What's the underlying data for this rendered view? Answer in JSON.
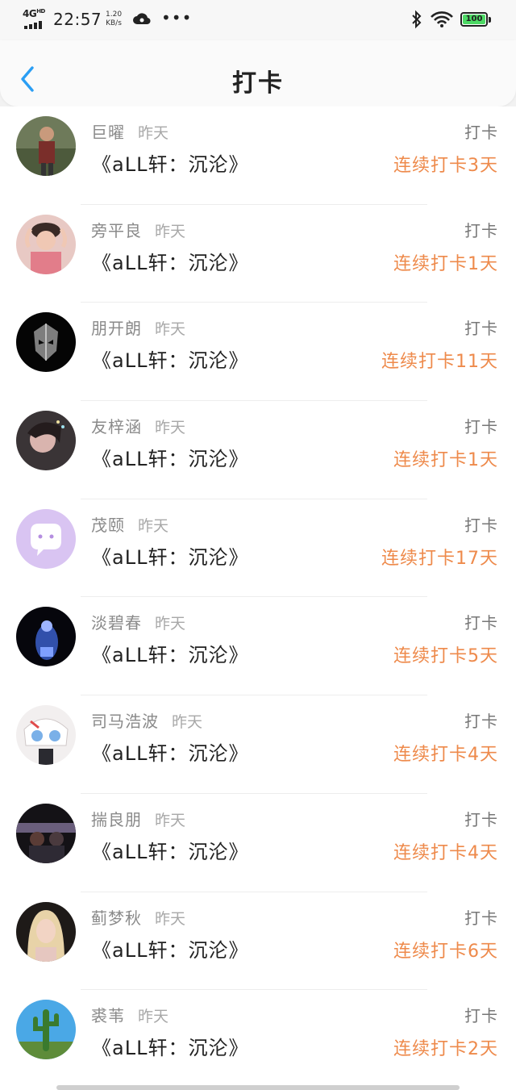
{
  "status_bar": {
    "network": "4G",
    "network_sup": "HD",
    "time": "22:57",
    "speed_value": "1.20",
    "speed_unit": "KB/s",
    "battery": "100",
    "icons": [
      "signal-icon",
      "cloud-icon",
      "more-dots-icon",
      "bluetooth-icon",
      "wifi-icon",
      "battery-icon"
    ]
  },
  "header": {
    "title": "打卡",
    "back_icon": "chevron-left-icon"
  },
  "colors": {
    "accent": "#2a9ef4",
    "streak": "#ee8a4b",
    "battery": "#4cd964"
  },
  "entries": [
    {
      "name": "巨曜",
      "time": "昨天",
      "book": "《aLL轩：沉沦》",
      "action": "打卡",
      "streak": "连续打卡3天",
      "avatar": "person-avatar"
    },
    {
      "name": "旁平良",
      "time": "昨天",
      "book": "《aLL轩：沉沦》",
      "action": "打卡",
      "streak": "连续打卡1天",
      "avatar": "person-avatar"
    },
    {
      "name": "朋开朗",
      "time": "昨天",
      "book": "《aLL轩：沉沦》",
      "action": "打卡",
      "streak": "连续打卡11天",
      "avatar": "mask-avatar"
    },
    {
      "name": "友梓涵",
      "time": "昨天",
      "book": "《aLL轩：沉沦》",
      "action": "打卡",
      "streak": "连续打卡1天",
      "avatar": "person-avatar"
    },
    {
      "name": "茂颐",
      "time": "昨天",
      "book": "《aLL轩：沉沦》",
      "action": "打卡",
      "streak": "连续打卡17天",
      "avatar": "chat-bubble-avatar"
    },
    {
      "name": "淡碧春",
      "time": "昨天",
      "book": "《aLL轩：沉沦》",
      "action": "打卡",
      "streak": "连续打卡5天",
      "avatar": "stage-avatar"
    },
    {
      "name": "司马浩波",
      "time": "昨天",
      "book": "《aLL轩：沉沦》",
      "action": "打卡",
      "streak": "连续打卡4天",
      "avatar": "anime-avatar"
    },
    {
      "name": "揣良朋",
      "time": "昨天",
      "book": "《aLL轩：沉沦》",
      "action": "打卡",
      "streak": "连续打卡4天",
      "avatar": "group-avatar"
    },
    {
      "name": "蓟梦秋",
      "time": "昨天",
      "book": "《aLL轩：沉沦》",
      "action": "打卡",
      "streak": "连续打卡6天",
      "avatar": "person-avatar"
    },
    {
      "name": "裘苇",
      "time": "昨天",
      "book": "《aLL轩：沉沦》",
      "action": "打卡",
      "streak": "连续打卡2天",
      "avatar": "cactus-avatar"
    }
  ]
}
